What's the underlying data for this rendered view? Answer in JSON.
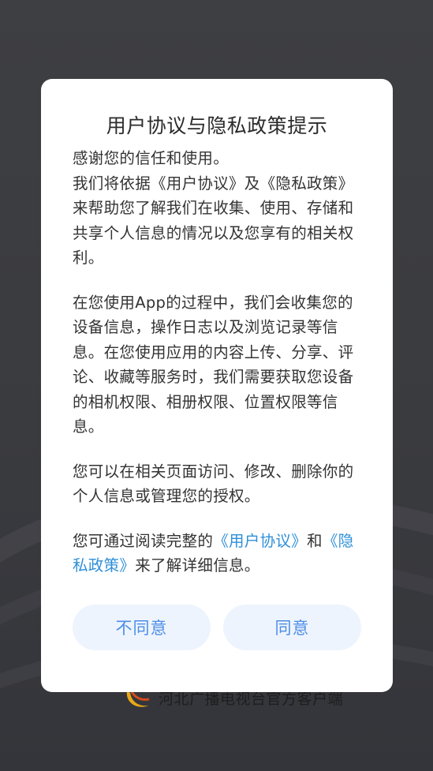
{
  "dialog": {
    "title": "用户协议与隐私政策提示",
    "p1_line1": "感谢您的信任和使用。",
    "p1_text_a": "我们将依据《用户协议》及《隐私政策》来帮助您了解我们在收集、使用、存储和共享个人信息的情况以及您享有的相关权利。",
    "p2": "在您使用App的过程中，我们会收集您的设备信息，操作日志以及浏览记录等信息。在您使用应用的内容上传、分享、评论、收藏等服务时，我们需要获取您设备的相机权限、相册权限、位置权限等信息。",
    "p3": "您可以在相关页面访问、修改、删除你的个人信息或管理您的授权。",
    "p4_prefix": "您可通过阅读完整的",
    "link_user_agreement": "《用户协议》",
    "p4_and": "和",
    "link_privacy_policy": "《隐私政策》",
    "p4_suffix": "来了解详细信息。",
    "disagree_label": "不同意",
    "agree_label": "同意"
  },
  "splash": {
    "tagline": "河北广播电视台官方客户端",
    "logo_icon": "swoosh-logo-icon"
  },
  "colors": {
    "link": "#2f8fd8",
    "button_bg": "#eef4fd",
    "button_text": "#4d8ee8",
    "background": "#3e3f43"
  }
}
